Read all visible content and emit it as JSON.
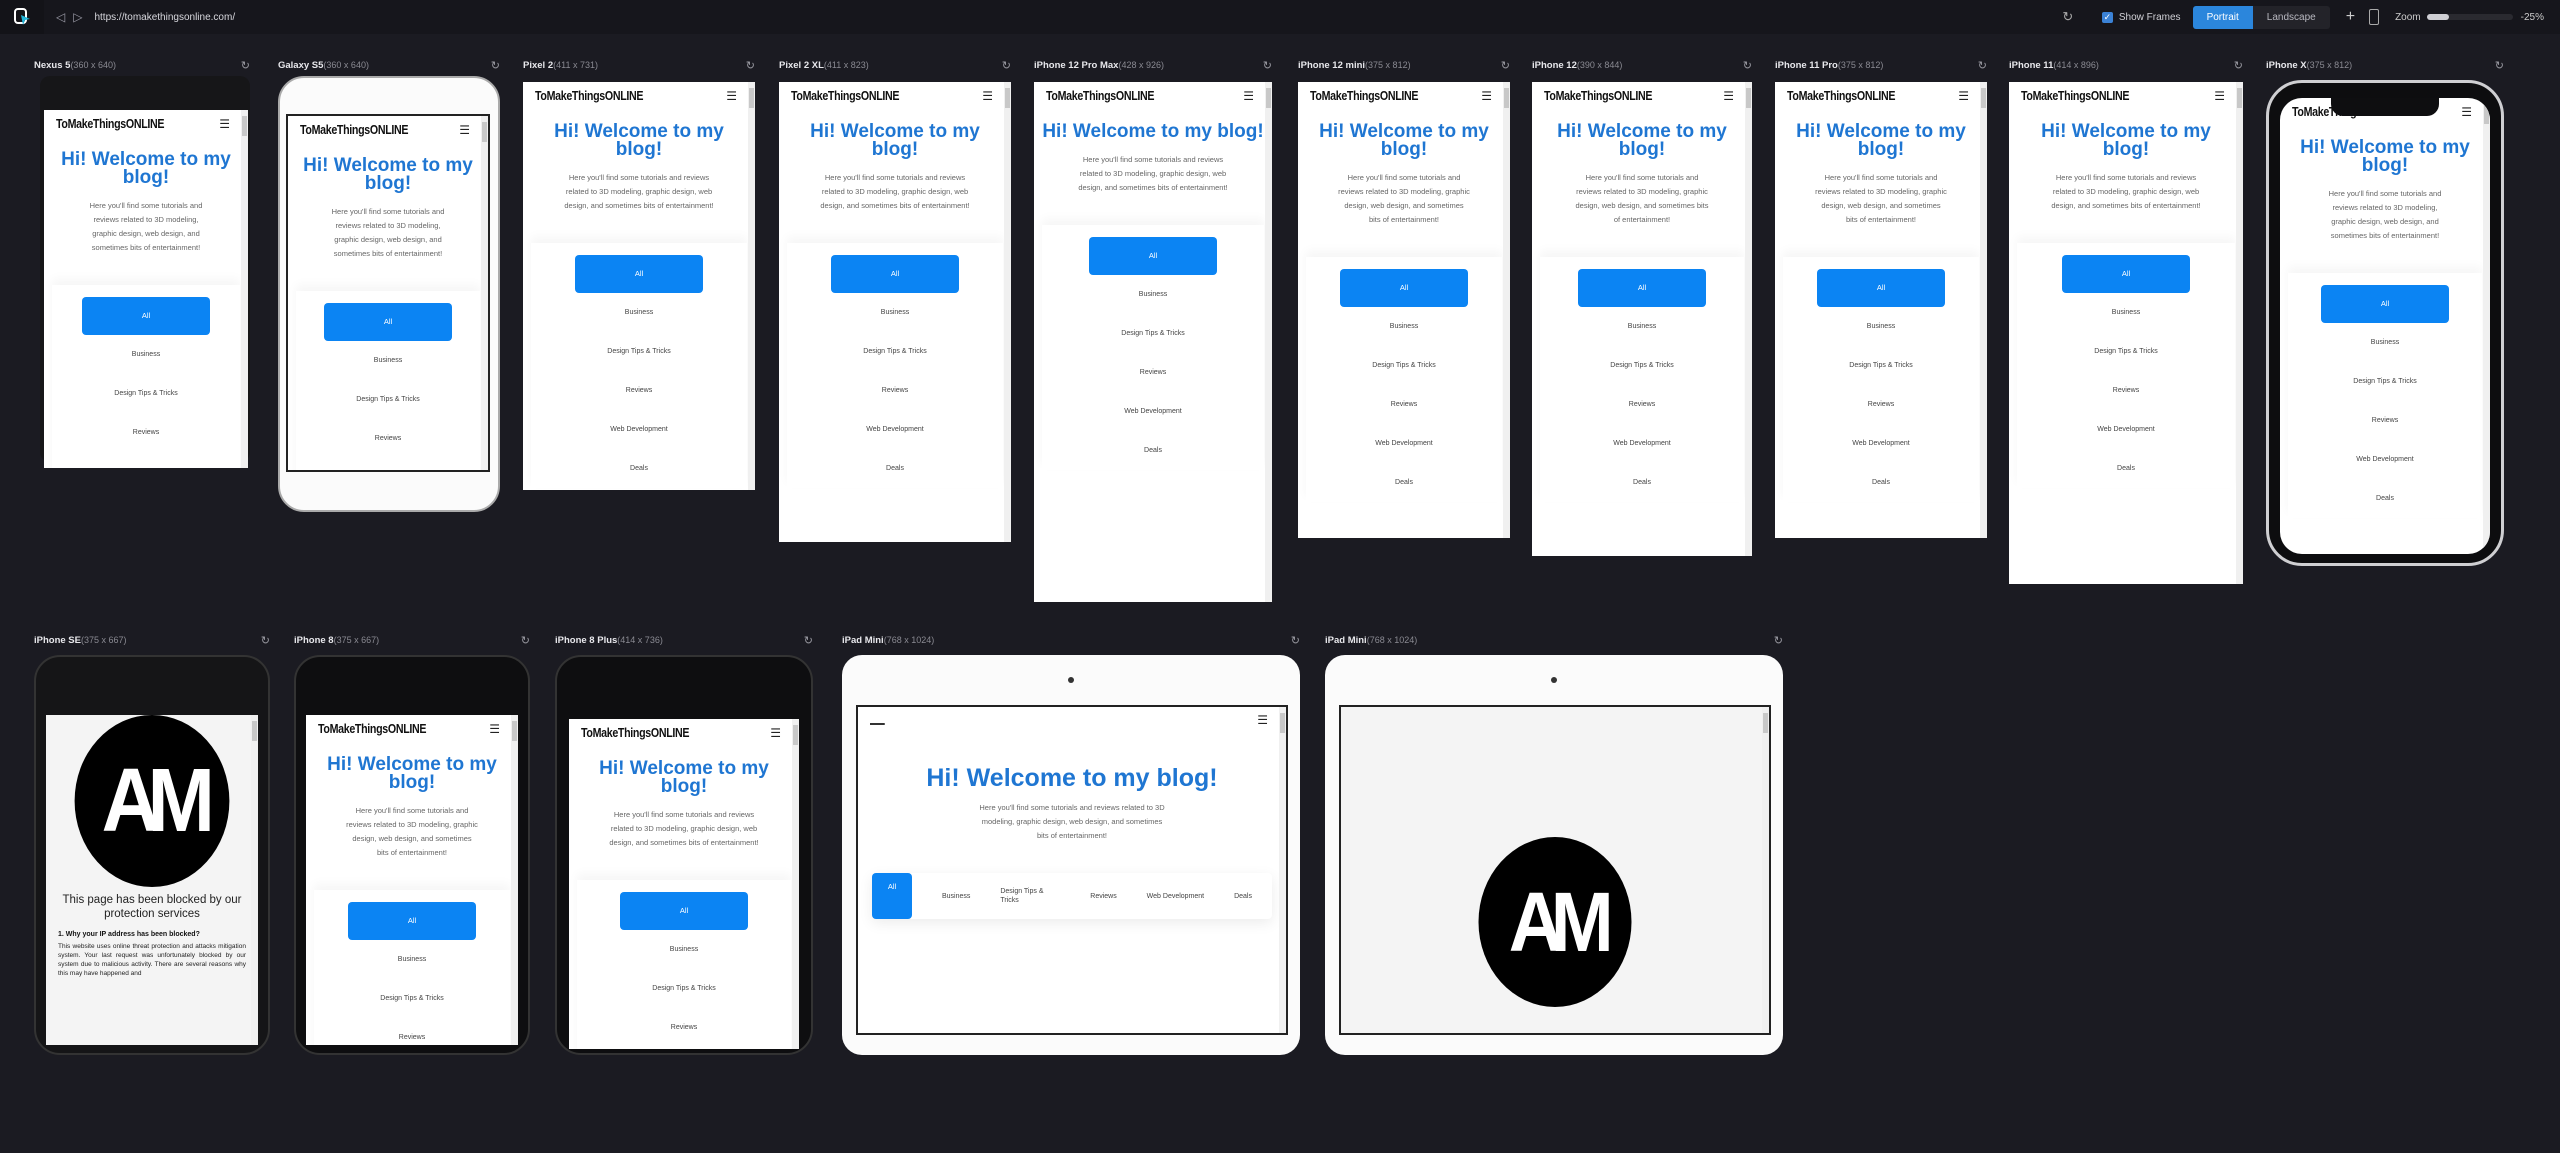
{
  "toolbar": {
    "url": "https://tomakethingsonline.com/",
    "show_frames_label": "Show Frames",
    "show_frames_checked": true,
    "orientation": {
      "portrait": "Portrait",
      "landscape": "Landscape",
      "selected": "Portrait"
    },
    "zoom_label": "Zoom",
    "zoom_value": "-25%"
  },
  "site": {
    "brand": "ToMakeThingsONLINE",
    "hero": "Hi! Welcome to my blog!",
    "intro": "Here you'll find some tutorials and reviews related to 3D modeling, graphic design, web design, and sometimes bits of entertainment!",
    "categories": [
      "All",
      "Business",
      "Design Tips & Tricks",
      "Reviews",
      "Web Development",
      "Deals"
    ],
    "active_category": "All"
  },
  "blocked_page": {
    "logo_text": "AM",
    "title": "This page has been blocked by our protection services",
    "question": "1. Why your IP address has been blocked?",
    "body": "This website uses online threat protection and attacks mitigation system. Your last request was unfortunately blocked by our system due to malicious activity. There are several reasons why this may have happened and"
  },
  "devices": [
    {
      "name": "Nexus 5",
      "size": "(360 x 640)"
    },
    {
      "name": "Galaxy S5",
      "size": "(360 x 640)"
    },
    {
      "name": "Pixel 2",
      "size": "(411 x 731)"
    },
    {
      "name": "Pixel 2 XL",
      "size": "(411 x 823)"
    },
    {
      "name": "iPhone 12 Pro Max",
      "size": "(428 x 926)"
    },
    {
      "name": "iPhone 12 mini",
      "size": "(375 x 812)"
    },
    {
      "name": "iPhone 12",
      "size": "(390 x 844)"
    },
    {
      "name": "iPhone 11 Pro",
      "size": "(375 x 812)"
    },
    {
      "name": "iPhone 11",
      "size": "(414 x 896)"
    },
    {
      "name": "iPhone X",
      "size": "(375 x 812)"
    },
    {
      "name": "iPhone SE",
      "size": "(375 x 667)"
    },
    {
      "name": "iPhone 8",
      "size": "(375 x 667)"
    },
    {
      "name": "iPhone 8 Plus",
      "size": "(414 x 736)"
    },
    {
      "name": "iPad Mini",
      "size": "(768 x 1024)"
    },
    {
      "name": "iPad Mini",
      "size": "(768 x 1024)"
    }
  ]
}
